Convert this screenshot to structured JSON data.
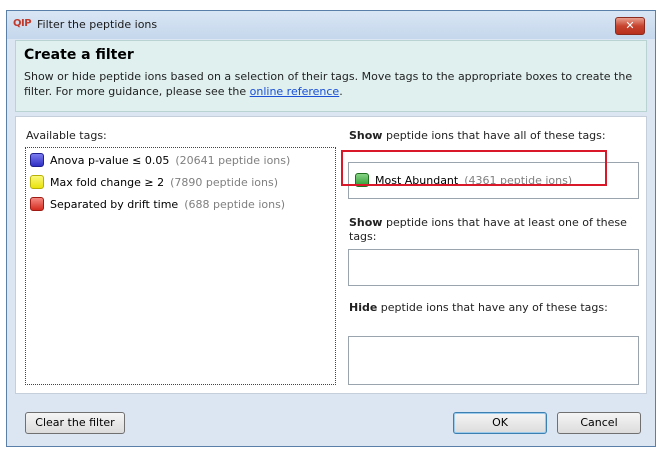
{
  "window": {
    "app_logo": "QIP",
    "title": "Filter the peptide ions",
    "close_label": "✕"
  },
  "header": {
    "title": "Create a filter",
    "description": "Show or hide peptide ions based on a selection of their tags. Move tags to the appropriate boxes to create the filter. For more guidance, please see the",
    "link_text": "online reference",
    "link_suffix": "."
  },
  "available": {
    "label": "Available tags:",
    "tags": [
      {
        "name": "Anova p-value ≤ 0.05",
        "count": "(20641 peptide ions)",
        "color": "#3b3bd6"
      },
      {
        "name": "Max fold change ≥ 2",
        "count": "(7890 peptide ions)",
        "color": "#f7f20f"
      },
      {
        "name": "Separated by drift time",
        "count": "(688 peptide ions)",
        "color": "#e53a2f"
      }
    ]
  },
  "show_all": {
    "label_bold": "Show",
    "label_rest": " peptide ions that have all of these tags:",
    "tags": [
      {
        "name": "Most Abundant",
        "count": "(4361 peptide ions)",
        "color": "#3aa33a"
      }
    ]
  },
  "show_any": {
    "label_bold": "Show",
    "label_rest": " peptide ions that have at least one of these tags:"
  },
  "hide_any": {
    "label_bold": "Hide",
    "label_rest": " peptide ions that have any of these tags:"
  },
  "footer": {
    "clear_label": "Clear the filter",
    "ok_label": "OK",
    "cancel_label": "Cancel"
  }
}
